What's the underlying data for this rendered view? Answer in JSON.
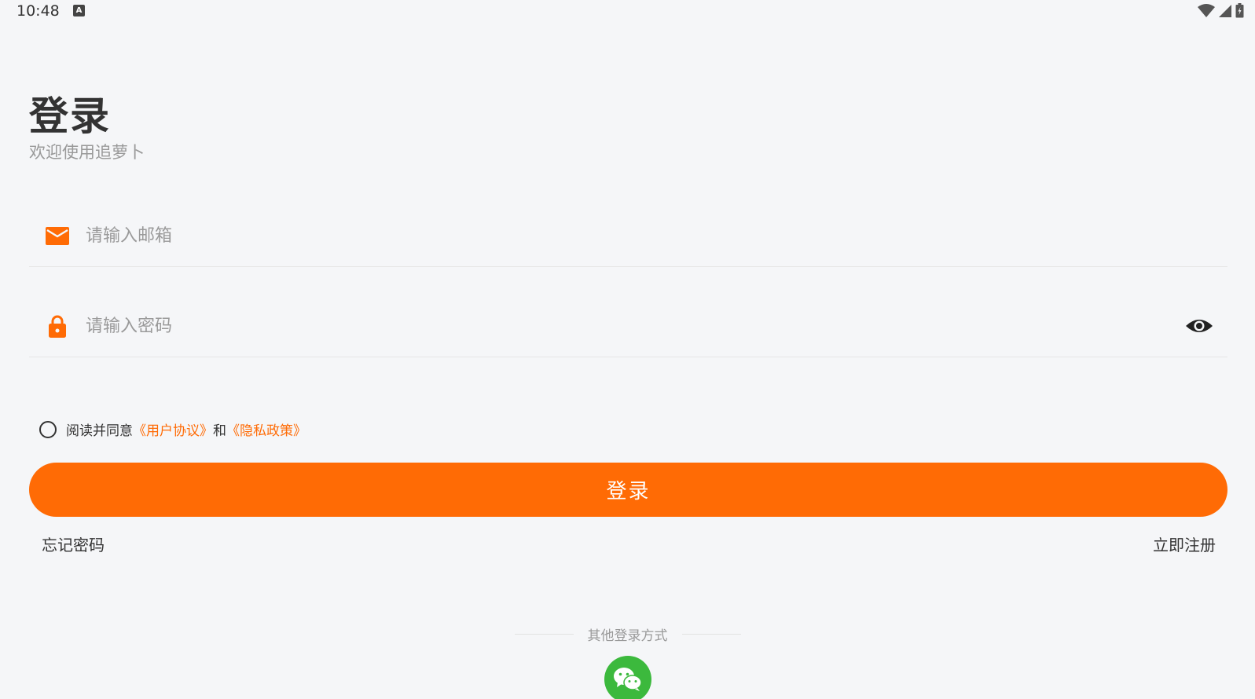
{
  "status_bar": {
    "time": "10:48",
    "app_icon_glyph": "A"
  },
  "header": {
    "title": "登录",
    "subtitle": "欢迎使用追萝卜"
  },
  "email_field": {
    "placeholder": "请输入邮箱",
    "value": "",
    "icon": "mail-icon"
  },
  "password_field": {
    "placeholder": "请输入密码",
    "value": "",
    "icon": "lock-icon",
    "toggle_icon": "eye-icon"
  },
  "agreement": {
    "prefix": "阅读并同意",
    "user_agreement": "《用户协议》",
    "conjunction": "和",
    "privacy_policy": "《隐私政策》",
    "checked": false
  },
  "login_button": {
    "label": "登录"
  },
  "links": {
    "forgot_password": "忘记密码",
    "register": "立即注册"
  },
  "other_login": {
    "label": "其他登录方式",
    "wechat_icon": "wechat-icon"
  },
  "colors": {
    "accent": "#ff6b05",
    "background": "#f5f6f8",
    "wechat": "#3cb93d"
  }
}
